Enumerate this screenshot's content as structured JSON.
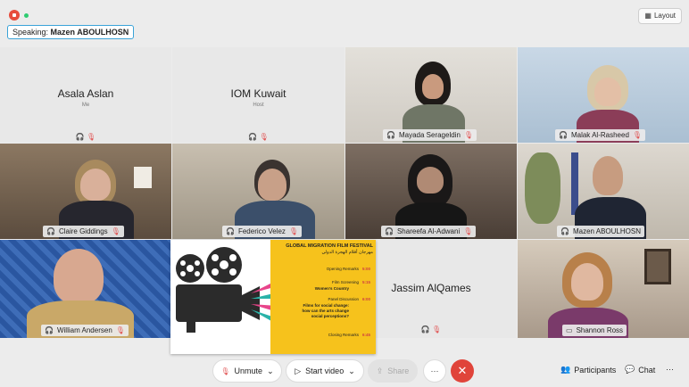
{
  "top": {
    "speaking_label": "Speaking:",
    "speaking_name": "Mazen ABOULHOSN",
    "layout_label": "Layout"
  },
  "participants": [
    {
      "name": "Asala Aslan",
      "subtitle": "Me"
    },
    {
      "name": "IOM Kuwait",
      "subtitle": "Host"
    },
    {
      "name": "Mayada Serageldin"
    },
    {
      "name": "Malak Al-Rasheed"
    },
    {
      "name": "Claire Giddings"
    },
    {
      "name": "Federico Velez"
    },
    {
      "name": "Shareefa Al-Adwani"
    },
    {
      "name": "Mazen ABOULHOSN"
    },
    {
      "name": "William Andersen"
    },
    {
      "name": "Jassim AlQames"
    },
    {
      "name": "Shannon Ross"
    }
  ],
  "poster": {
    "title": "GLOBAL MIGRATION FILM FESTIVAL",
    "arabic": "مهرجان أفلام الهجرة الدولي",
    "items": [
      {
        "label": "Opening Remarks",
        "time": "5:00"
      },
      {
        "label": "Film Screening",
        "sub": "Women's Country",
        "time": "5:15"
      },
      {
        "label": "Panel Discussion",
        "sub": "Films for social change: how can the arts change social perceptions?",
        "time": "6:00"
      },
      {
        "label": "Closing Remarks",
        "time": "6:45"
      }
    ]
  },
  "toolbar": {
    "unmute": "Unmute",
    "start_video": "Start video",
    "share": "Share",
    "more": "···",
    "participants": "Participants",
    "chat": "Chat",
    "overflow": "···"
  },
  "colors": {
    "accent": "#3aa3d8",
    "end_call": "#e0443a",
    "mic_muted": "#e05050",
    "poster_yellow": "#f6c21c"
  }
}
